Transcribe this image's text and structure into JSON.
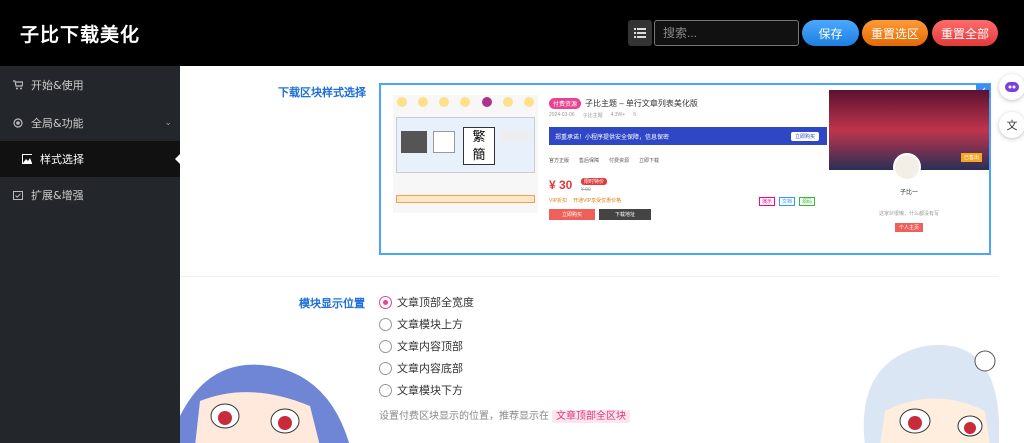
{
  "header": {
    "logo": "子比下载美化",
    "search_placeholder": "搜索...",
    "save_label": "保存",
    "reset_selection_label": "重置选区",
    "reset_all_label": "重置全部"
  },
  "sidebar": {
    "items": [
      {
        "label": "开始&使用",
        "icon": "cart-icon"
      },
      {
        "label": "全局&功能",
        "icon": "circle-dot-icon"
      },
      {
        "label": "样式选择",
        "icon": "image-icon",
        "active": true
      },
      {
        "label": "扩展&增强",
        "icon": "calendar-check-icon"
      }
    ]
  },
  "main": {
    "style_label": "下载区块样式选择",
    "position_label": "模块显示位置",
    "position_options": [
      {
        "label": "文章顶部全宽度",
        "selected": true
      },
      {
        "label": "文章模块上方",
        "selected": false
      },
      {
        "label": "文章内容顶部",
        "selected": false
      },
      {
        "label": "文章内容底部",
        "selected": false
      },
      {
        "label": "文章模块下方",
        "selected": false
      }
    ],
    "hint_text": "设置付费区块显示的位置，推荐显示在",
    "hint_tag": "文章顶部全区块"
  },
  "preview": {
    "badge": "付费资源",
    "title": "子比主题 – 单行文章列表美化版",
    "meta": [
      "2024-03-06",
      "子比主题",
      "4.3W+",
      "5"
    ],
    "notice": "郑重承诺！小程序提供安全保障，信息保密",
    "notice_btn": "立即购买",
    "tags": [
      "官方正版",
      "售后保障",
      "付费资源",
      "立即下载"
    ],
    "price": "¥ 30",
    "price_badge": "限时特价",
    "original_price": "¥ 99",
    "vip_text": "开通VIP享受优惠价格",
    "vip_label": "VIP折扣",
    "btn_buy": "立即购买",
    "btn_download": "下载地址",
    "chips": [
      "演示",
      "文档",
      "源码"
    ],
    "side_tag": "已售出",
    "username": "子比一",
    "user_desc": "这家伙很懒，什么都没有写",
    "user_btn": "个人主页"
  },
  "colors": {
    "accent": "#1e6fd8",
    "save": "#2b8ff0",
    "reset_selection": "#f08022",
    "reset_all": "#f04a4a",
    "selected_radio": "#e84393"
  }
}
